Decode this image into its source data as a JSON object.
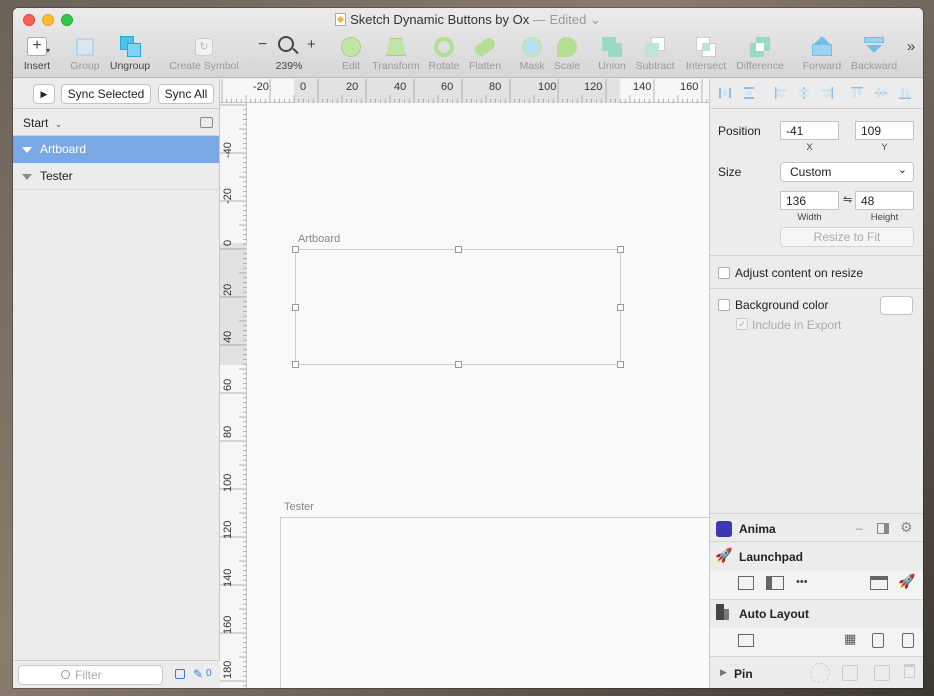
{
  "window": {
    "title": "Sketch Dynamic Buttons by Ox",
    "edited": "— Edited"
  },
  "toolbar": {
    "insert": "Insert",
    "group": "Group",
    "ungroup": "Ungroup",
    "create_symbol": "Create Symbol",
    "zoom_minus": "−",
    "zoom_plus": "+",
    "zoom_level": "239%",
    "edit": "Edit",
    "transform": "Transform",
    "rotate": "Rotate",
    "flatten": "Flatten",
    "mask": "Mask",
    "scale": "Scale",
    "union": "Union",
    "subtract": "Subtract",
    "intersect": "Intersect",
    "difference": "Difference",
    "forward": "Forward",
    "backward": "Backward",
    "overflow": "»"
  },
  "sidebar": {
    "play_symbol": "▶",
    "sync_selected": "Sync Selected",
    "sync_all": "Sync All",
    "page_name": "Start",
    "layers": [
      {
        "name": "Artboard",
        "selected": true
      },
      {
        "name": "Tester",
        "selected": false
      }
    ],
    "filter_placeholder": "Filter",
    "edit_count": "0"
  },
  "rulers": {
    "top": [
      "-20",
      "0",
      "20",
      "40",
      "60",
      "80",
      "100",
      "120",
      "140",
      "160"
    ],
    "left": [
      "-40",
      "-20",
      "0",
      "20",
      "40",
      "60",
      "80",
      "100",
      "120",
      "140",
      "160",
      "180"
    ]
  },
  "canvas": {
    "artboards": [
      {
        "label": "Artboard"
      },
      {
        "label": "Tester"
      }
    ]
  },
  "inspector": {
    "position_label": "Position",
    "x_value": "-41",
    "y_value": "109",
    "x_label": "X",
    "y_label": "Y",
    "size_label": "Size",
    "size_preset": "Custom",
    "width_value": "136",
    "height_value": "48",
    "link_symbol": "⇋",
    "width_label": "Width",
    "height_label": "Height",
    "resize_to_fit": "Resize to Fit",
    "adjust_content": "Adjust content on resize",
    "background_color": "Background color",
    "include_in_export": "Include in Export",
    "include_check": "✓"
  },
  "plugins": {
    "anima": "Anima",
    "anima_min": "_",
    "launchpad": "Launchpad",
    "more_dots": "•••",
    "auto_layout": "Auto Layout",
    "pin": "Pin"
  },
  "colors": {
    "selection": "#7aa8e4",
    "anima_brand": "#3a3ab0",
    "close": "#fc5f57",
    "minimize": "#fdbc2e",
    "maximize": "#34c84a"
  }
}
